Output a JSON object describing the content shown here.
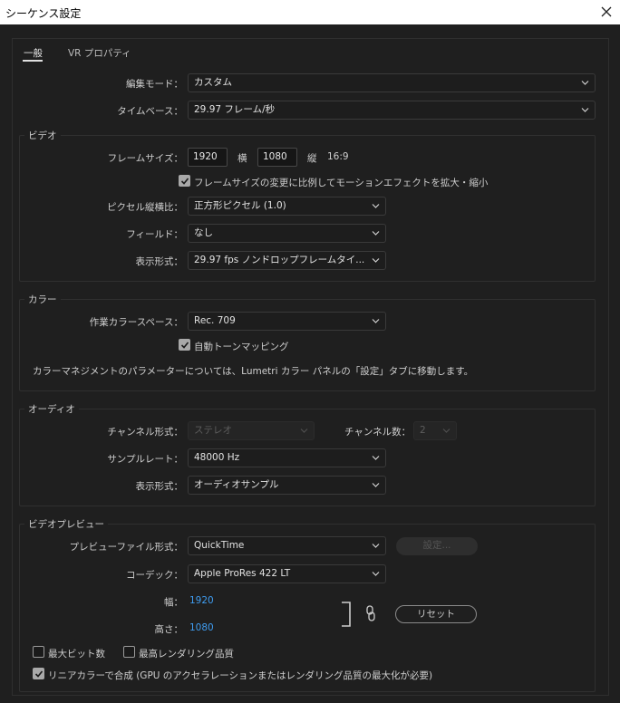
{
  "window": {
    "title": "シーケンス設定"
  },
  "tabs": [
    {
      "label": "一般"
    },
    {
      "label": "VR プロパティ"
    }
  ],
  "general": {
    "edit_mode_label": "編集モード：",
    "edit_mode_value": "カスタム",
    "timebase_label": "タイムベース：",
    "timebase_value": "29.97  フレーム/秒"
  },
  "video": {
    "title": "ビデオ",
    "frame_size_label": "フレームサイズ：",
    "width_value": "1920",
    "width_unit": "横",
    "height_value": "1080",
    "height_unit": "縦",
    "aspect": "16:9",
    "scale_checkbox_label": "フレームサイズの変更に比例してモーションエフェクトを拡大・縮小",
    "scale_checkbox_checked": true,
    "pixel_aspect_label": "ピクセル縦横比：",
    "pixel_aspect_value": "正方形ピクセル (1.0)",
    "fields_label": "フィールド：",
    "fields_value": "なし",
    "display_format_label": "表示形式：",
    "display_format_value": "29.97  fps ノンドロップフレームタイ..."
  },
  "color": {
    "title": "カラー",
    "working_space_label": "作業カラースペース：",
    "working_space_value": "Rec. 709",
    "auto_tone_label": "自動トーンマッピング",
    "auto_tone_checked": true,
    "info_text": "カラーマネジメントのパラメーターについては、Lumetri カラー パネルの「設定」タブに移動します。"
  },
  "audio": {
    "title": "オーディオ",
    "channel_format_label": "チャンネル形式：",
    "channel_format_value": "ステレオ",
    "channel_count_label": "チャンネル数：",
    "channel_count_value": "2",
    "sample_rate_label": "サンプルレート：",
    "sample_rate_value": "48000 Hz",
    "display_format_label": "表示形式：",
    "display_format_value": "オーディオサンプル"
  },
  "preview": {
    "title": "ビデオプレビュー",
    "file_format_label": "プレビューファイル形式：",
    "file_format_value": "QuickTime",
    "settings_button": "設定...",
    "codec_label": "コーデック：",
    "codec_value": "Apple ProRes 422 LT",
    "width_label": "幅：",
    "width_value": "1920",
    "height_label": "高さ：",
    "height_value": "1080",
    "reset_button": "リセット"
  },
  "options": {
    "max_bit_depth_label": "最大ビット数",
    "max_bit_depth_checked": false,
    "max_render_quality_label": "最高レンダリング品質",
    "max_render_quality_checked": false,
    "linear_color_label": "リニアカラーで合成 (GPU のアクセラレーションまたはレンダリング品質の最大化が必要)",
    "linear_color_checked": true
  },
  "colors": {
    "background": "#1f1f1f",
    "accent_blue": "#3f9cf0",
    "titlebar": "#ffffff"
  }
}
